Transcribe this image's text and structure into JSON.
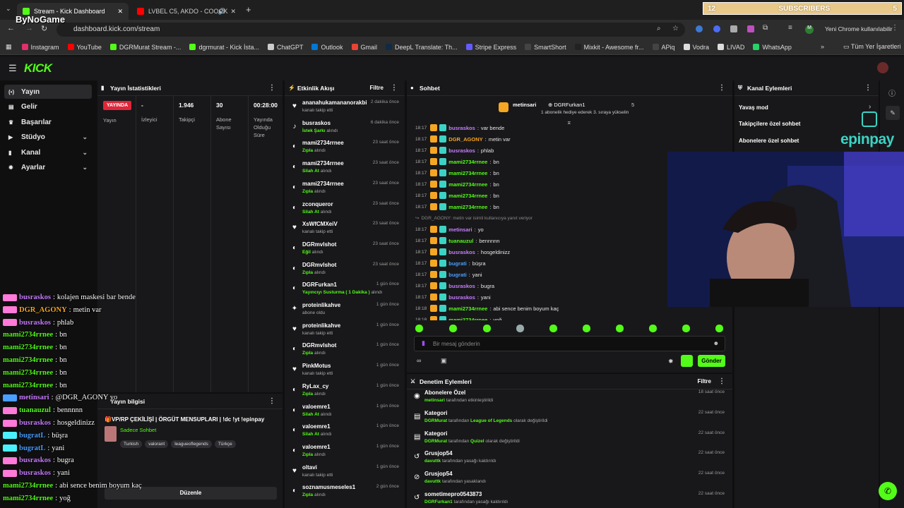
{
  "browser": {
    "tabs": [
      {
        "title": "Stream - Kick Dashboard",
        "color": "#53fc18"
      },
      {
        "title": "LVBEL C5, AKDO - COOOK",
        "color": "#ff0000"
      }
    ],
    "url": "dashboard.kick.com/stream",
    "profile_label": "Yeni Chrome kullanılabilir",
    "watermark": "ByNoGame",
    "bookmarks": [
      {
        "label": "Instagram",
        "color": "#e1306c"
      },
      {
        "label": "YouTube",
        "color": "#ff0000"
      },
      {
        "label": "DGRMurat Stream -...",
        "color": "#53fc18"
      },
      {
        "label": "dgrmurat - Kick İsta...",
        "color": "#53fc18"
      },
      {
        "label": "ChatGPT",
        "color": "#cccccc"
      },
      {
        "label": "Outlook",
        "color": "#0078d4"
      },
      {
        "label": "Gmail",
        "color": "#ea4335"
      },
      {
        "label": "DeepL Translate: Th...",
        "color": "#0f2b46"
      },
      {
        "label": "Stripe Express",
        "color": "#635bff"
      },
      {
        "label": "SmartShort",
        "color": "#444444"
      },
      {
        "label": "Mixkit - Awesome fr...",
        "color": "#222222"
      },
      {
        "label": "APiq",
        "color": "#444444"
      },
      {
        "label": "Vodra",
        "color": "#dddddd"
      },
      {
        "label": "LIVAD",
        "color": "#dddddd"
      },
      {
        "label": "WhatsApp",
        "color": "#25d366"
      }
    ],
    "all_bookmarks": "Tüm Yer İşaretleri"
  },
  "subscribers_bar": {
    "left": "12",
    "label": "SUBSCRIBERS",
    "right": "5"
  },
  "kick": {
    "logo": "KICK",
    "sidebar": [
      {
        "label": "Yayın",
        "icon": "broadcast-icon",
        "active": true,
        "chevron": false
      },
      {
        "label": "Gelir",
        "icon": "wallet-icon",
        "active": false,
        "chevron": false
      },
      {
        "label": "Başarılar",
        "icon": "trophy-icon",
        "active": false,
        "chevron": false
      },
      {
        "label": "Stüdyo",
        "icon": "studio-icon",
        "active": false,
        "chevron": true
      },
      {
        "label": "Kanal",
        "icon": "channel-icon",
        "active": false,
        "chevron": true
      },
      {
        "label": "Ayarlar",
        "icon": "settings-icon",
        "active": false,
        "chevron": true
      }
    ]
  },
  "stats": {
    "title": "Yayın İstatistikleri",
    "live_badge": "YAYINDA",
    "items": [
      {
        "value": "-",
        "label": "İzleyici"
      },
      {
        "value": "1.946",
        "label": "Takipçi"
      },
      {
        "value": "30",
        "label": "Abone Sayısı"
      },
      {
        "value": "00:28:00",
        "label": "Yayında Olduğu Süre"
      }
    ],
    "status_label": "Yayın"
  },
  "stream_info": {
    "title": "Yayın bilgisi",
    "stream_title": "VP/RP ÇEKİLİŞİ | ÖRGÜT MENSUPLARI | !dc !yt !epinpay",
    "category": "Sadece Sohbet",
    "tags": [
      "Turkish",
      "valorant",
      "leagueoflegends",
      "Türkçe"
    ],
    "edit_button": "Düzenle"
  },
  "activity": {
    "title": "Etkinlik Akışı",
    "filter": "Filtre",
    "items": [
      {
        "icon": "heart-icon",
        "name": "ananahukamananorakbi",
        "sub_pre": "",
        "sub_hl": "",
        "sub_post": "kanalı takip etti",
        "time": "2 dakika önce"
      },
      {
        "icon": "music-icon",
        "name": "busraskos",
        "sub_pre": "",
        "sub_hl": "İstek Şarkı",
        "sub_post": "alındı",
        "time": "6 dakika önce"
      },
      {
        "icon": "reward-icon",
        "name": "mami2734rrnee",
        "sub_pre": "",
        "sub_hl": "Zıpla",
        "sub_post": "alındı",
        "time": "23 saat önce"
      },
      {
        "icon": "reward-icon",
        "name": "mami2734rrnee",
        "sub_pre": "",
        "sub_hl": "Silah At",
        "sub_post": "alındı",
        "time": "23 saat önce"
      },
      {
        "icon": "reward-icon",
        "name": "mami2734rrnee",
        "sub_pre": "",
        "sub_hl": "Zıpla",
        "sub_post": "alındı",
        "time": "23 saat önce"
      },
      {
        "icon": "reward-icon",
        "name": "zconqueror",
        "sub_pre": "",
        "sub_hl": "Silah At",
        "sub_post": "alındı",
        "time": "23 saat önce"
      },
      {
        "icon": "heart-icon",
        "name": "XsWfCMXeiV",
        "sub_pre": "",
        "sub_hl": "",
        "sub_post": "kanalı takip etti",
        "time": "23 saat önce"
      },
      {
        "icon": "reward-icon",
        "name": "DGRmvlshot",
        "sub_pre": "",
        "sub_hl": "Eğil",
        "sub_post": "alındı",
        "time": "23 saat önce"
      },
      {
        "icon": "reward-icon",
        "name": "DGRmvlshot",
        "sub_pre": "",
        "sub_hl": "Zıpla",
        "sub_post": "alındı",
        "time": "23 saat önce"
      },
      {
        "icon": "reward-icon",
        "name": "DGRFurkan1",
        "sub_pre": "",
        "sub_hl": "Yayıncıyı Susturma ( 1 Dakika )",
        "sub_post": "alındı",
        "time": "1 gün önce"
      },
      {
        "icon": "sparkle-icon",
        "name": "proteinlikahve",
        "sub_pre": "",
        "sub_hl": "",
        "sub_post": "abone oldu",
        "time": "1 gün önce"
      },
      {
        "icon": "heart-icon",
        "name": "proteinlikahve",
        "sub_pre": "",
        "sub_hl": "",
        "sub_post": "kanalı takip etti",
        "time": "1 gün önce"
      },
      {
        "icon": "reward-icon",
        "name": "DGRmvlshot",
        "sub_pre": "",
        "sub_hl": "Zıpla",
        "sub_post": "alındı",
        "time": "1 gün önce"
      },
      {
        "icon": "heart-icon",
        "name": "PinkMotus",
        "sub_pre": "",
        "sub_hl": "",
        "sub_post": "kanalı takip etti",
        "time": "1 gün önce"
      },
      {
        "icon": "reward-icon",
        "name": "RyLax_cy",
        "sub_pre": "",
        "sub_hl": "Zıpla",
        "sub_post": "alındı",
        "time": "1 gün önce"
      },
      {
        "icon": "reward-icon",
        "name": "valoemre1",
        "sub_pre": "",
        "sub_hl": "Silah At",
        "sub_post": "alındı",
        "time": "1 gün önce"
      },
      {
        "icon": "reward-icon",
        "name": "valoemre1",
        "sub_pre": "",
        "sub_hl": "Silah At",
        "sub_post": "alındı",
        "time": "1 gün önce"
      },
      {
        "icon": "reward-icon",
        "name": "valoemre1",
        "sub_pre": "",
        "sub_hl": "Zıpla",
        "sub_post": "alındı",
        "time": "1 gün önce"
      },
      {
        "icon": "heart-icon",
        "name": "oltavi",
        "sub_pre": "",
        "sub_hl": "",
        "sub_post": "kanalı takip etti",
        "time": "1 gün önce"
      },
      {
        "icon": "reward-icon",
        "name": "soznamusmeseles1",
        "sub_pre": "",
        "sub_hl": "Zıpla",
        "sub_post": "alındı",
        "time": "2 gün önce"
      }
    ]
  },
  "chat": {
    "title": "Sohbet",
    "pinned": {
      "user1": "metinsari",
      "user2": "DGRFurkan1",
      "count": "5",
      "note": "1 abonelik hediye ederek 3. sıraya yükselin"
    },
    "messages": [
      {
        "time": "18:17",
        "user": "busraskos",
        "color": "#c77dff",
        "text": "var bende"
      },
      {
        "time": "18:17",
        "user": "DGR_AGONY",
        "color": "#f5a623",
        "text": "metin var"
      },
      {
        "time": "18:17",
        "user": "busraskos",
        "color": "#c77dff",
        "text": "phlab"
      },
      {
        "time": "18:17",
        "user": "mami2734rrnee",
        "color": "#53fc18",
        "text": "bn"
      },
      {
        "time": "18:17",
        "user": "mami2734rrnee",
        "color": "#53fc18",
        "text": "bn"
      },
      {
        "time": "18:17",
        "user": "mami2734rrnee",
        "color": "#53fc18",
        "text": "bn"
      },
      {
        "time": "18:17",
        "user": "mami2734rrnee",
        "color": "#53fc18",
        "text": "bn"
      },
      {
        "time": "18:17",
        "user": "mami2734rrnee",
        "color": "#53fc18",
        "text": "bn"
      },
      {
        "time": "",
        "user": "",
        "color": "#888888",
        "text": "DGR_AGONY: metin var isimli kullanıcıya yanıt veriyor"
      },
      {
        "time": "18:17",
        "user": "metinsari",
        "color": "#c77dff",
        "text": "yo"
      },
      {
        "time": "18:17",
        "user": "tuanauzul",
        "color": "#53fc18",
        "text": "bennnnn"
      },
      {
        "time": "18:17",
        "user": "busraskos",
        "color": "#c77dff",
        "text": "hosgeldinizz"
      },
      {
        "time": "18:17",
        "user": "bugrati",
        "color": "#4a9eff",
        "text": "büşra"
      },
      {
        "time": "18:17",
        "user": "bugrati",
        "color": "#4a9eff",
        "text": "yani"
      },
      {
        "time": "18:17",
        "user": "busraskos",
        "color": "#c77dff",
        "text": "bugra"
      },
      {
        "time": "18:17",
        "user": "busraskos",
        "color": "#c77dff",
        "text": "yani"
      },
      {
        "time": "18:18",
        "user": "mami2734rrnee",
        "color": "#53fc18",
        "text": "abi sence benim boyum kaç"
      },
      {
        "time": "18:18",
        "user": "mami2734rrnee",
        "color": "#53fc18",
        "text": "yoğ"
      }
    ],
    "input_placeholder": "Bir mesaj gönderin",
    "send_button": "Gönder"
  },
  "channel_actions": {
    "title": "Kanal Eylemleri",
    "items": [
      "Yavaş mod",
      "Takipçilere özel sohbet",
      "Abonelere özel sohbet"
    ],
    "sponsor": "epinpay"
  },
  "moderation": {
    "title": "Denetim Eylemleri",
    "filter": "Filtre",
    "items": [
      {
        "icon": "chat-icon",
        "name": "Abonelere Özel",
        "actor": "metinsari",
        "mid": "tarafından etkinleştirildi",
        "hl": "",
        "post": "",
        "time": "18 saat önce"
      },
      {
        "icon": "category-icon",
        "name": "Kategori",
        "actor": "DGRMurat",
        "mid": "tarafından",
        "hl": "League of Legends",
        "post": "olarak değiştirildi",
        "time": "22 saat önce"
      },
      {
        "icon": "category-icon",
        "name": "Kategori",
        "actor": "DGRMurat",
        "mid": "tarafından",
        "hl": "Quizel",
        "post": "olarak değiştirildi",
        "time": "22 saat önce"
      },
      {
        "icon": "unban-icon",
        "name": "Grusjop54",
        "actor": "davuttk",
        "mid": "tarafından yasağı kaldırıldı",
        "hl": "",
        "post": "",
        "time": "22 saat önce"
      },
      {
        "icon": "ban-icon",
        "name": "Grusjop54",
        "actor": "davuttk",
        "mid": "tarafından yasaklandı",
        "hl": "",
        "post": "",
        "time": "22 saat önce"
      },
      {
        "icon": "unban-icon",
        "name": "sometimepro0543873",
        "actor": "DGRFurkan1",
        "mid": "tarafından yasağı kaldırıldı",
        "hl": "",
        "post": "",
        "time": "22 saat önce"
      }
    ]
  },
  "overlay_chat": [
    {
      "user": "busraskos",
      "color": "#c77dff",
      "badge": "#ff7ad9",
      "text": "kolajen maskesi bar bende"
    },
    {
      "user": "DGR_AGONY",
      "color": "#f5a623",
      "badge": "#ff7ad9",
      "text": "metin var"
    },
    {
      "user": "busraskos",
      "color": "#c77dff",
      "badge": "#ff7ad9",
      "text": "phlab"
    },
    {
      "user": "mami2734rrnee",
      "color": "#53fc18",
      "badge": "",
      "text": "bn"
    },
    {
      "user": "mami2734rrnee",
      "color": "#53fc18",
      "badge": "",
      "text": "bn"
    },
    {
      "user": "mami2734rrnee",
      "color": "#53fc18",
      "badge": "",
      "text": "bn"
    },
    {
      "user": "mami2734rrnee",
      "color": "#53fc18",
      "badge": "",
      "text": "bn"
    },
    {
      "user": "mami2734rrnee",
      "color": "#53fc18",
      "badge": "",
      "text": "bn"
    },
    {
      "user": "metinsari",
      "color": "#c77dff",
      "badge": "#4a9eff",
      "text": "@DGR_AGONY yo"
    },
    {
      "user": "tuanauzul",
      "color": "#53fc18",
      "badge": "#ff7ad9",
      "text": "bennnnn"
    },
    {
      "user": "busraskos",
      "color": "#c77dff",
      "badge": "#ff7ad9",
      "text": "hosgeldinizz"
    },
    {
      "user": "bugratL",
      "color": "#4a9eff",
      "badge": "#4af0ff",
      "text": "büşra"
    },
    {
      "user": "bugratL",
      "color": "#4a9eff",
      "badge": "#4af0ff",
      "text": "yani"
    },
    {
      "user": "busraskos",
      "color": "#c77dff",
      "badge": "#ff7ad9",
      "text": "bugra"
    },
    {
      "user": "busraskos",
      "color": "#c77dff",
      "badge": "#ff7ad9",
      "text": "yani"
    },
    {
      "user": "mami2734rrnee",
      "color": "#53fc18",
      "badge": "",
      "text": "abi sence benim boyum kaç"
    },
    {
      "user": "mami2734rrnee",
      "color": "#53fc18",
      "badge": "",
      "text": "yoğ"
    }
  ]
}
